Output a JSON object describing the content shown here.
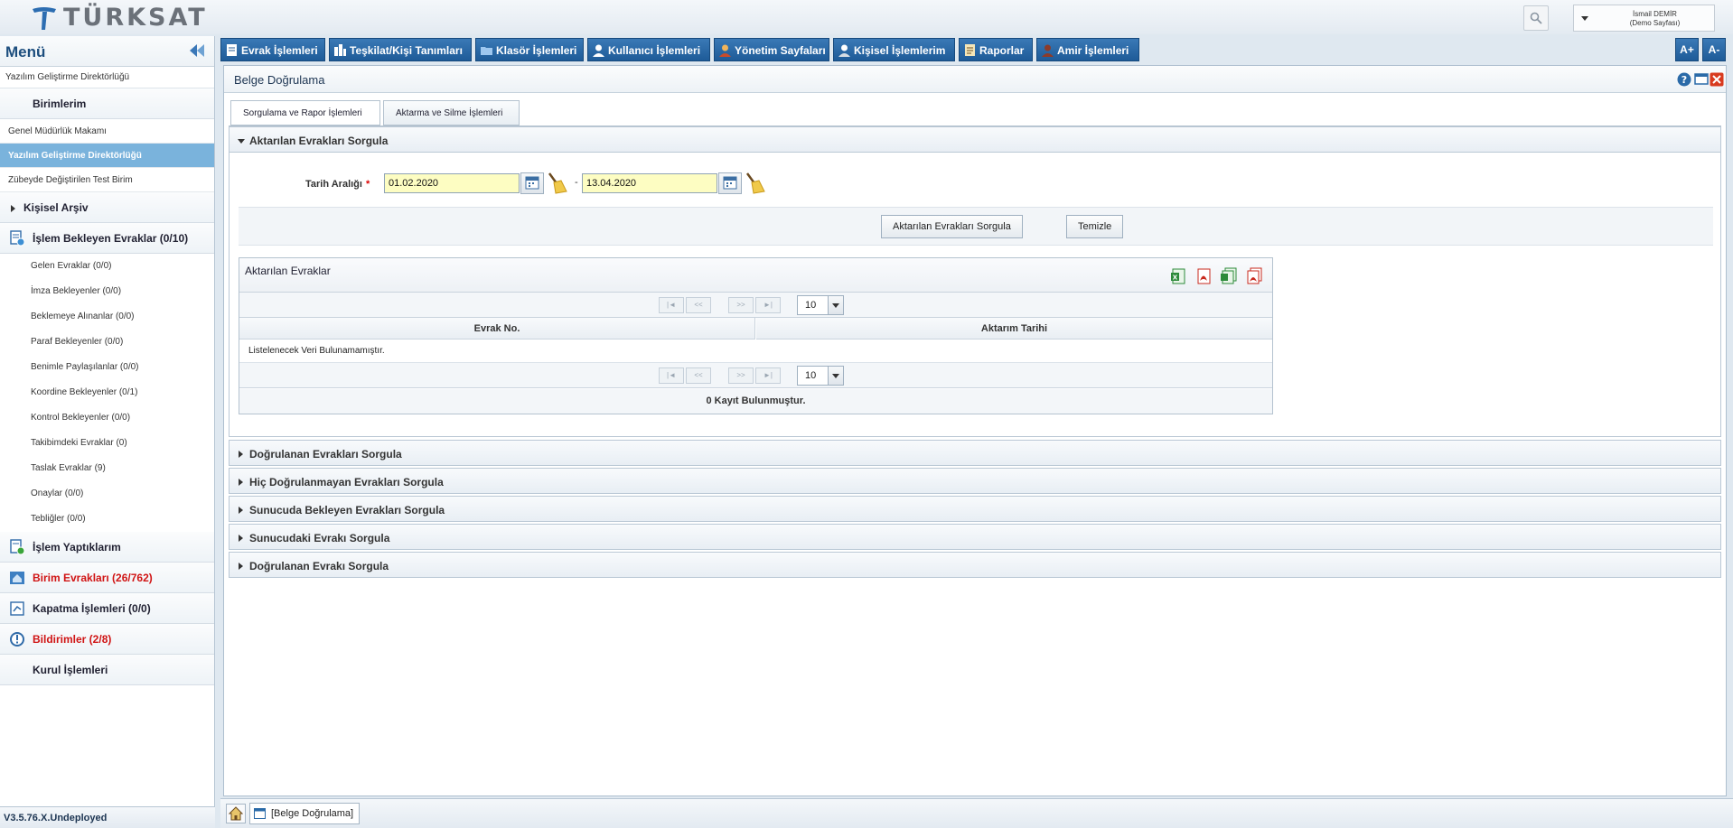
{
  "brand": {
    "name": "TÜRKSAT"
  },
  "user": {
    "name": "İsmail DEMİR",
    "role": "(Demo Sayfası)"
  },
  "sidebar": {
    "title": "Menü",
    "current_unit": "Yazılım Geliştirme Direktörlüğü",
    "units_header": "Birimlerim",
    "units": [
      "Genel Müdürlük Makamı",
      "Yazılım Geliştirme Direktörlüğü",
      "Zübeyde Değiştirilen Test Birim"
    ],
    "personal_archive": "Kişisel Arşiv",
    "pending_header": "İşlem Bekleyen Evraklar (0/10)",
    "pending_items": [
      "Gelen Evraklar (0/0)",
      "İmza Bekleyenler (0/0)",
      "Beklemeye Alınanlar (0/0)",
      "Paraf Bekleyenler (0/0)",
      "Benimle Paylaşılanlar (0/0)",
      "Koordine Bekleyenler (0/1)",
      "Kontrol Bekleyenler (0/0)",
      "Takibimdeki Evraklar (0)",
      "Taslak Evraklar (9)",
      "Onaylar (0/0)",
      "Tebliğler (0/0)"
    ],
    "done": "İşlem Yaptıklarım",
    "unit_docs": "Birim Evrakları (26/762)",
    "closing": "Kapatma İşlemleri (0/0)",
    "notifications": "Bildirimler (2/8)",
    "board": "Kurul İşlemleri",
    "version": "V3.5.76.X.Undeployed"
  },
  "nav": {
    "items": [
      "Evrak İşlemleri",
      "Teşkilat/Kişi Tanımları",
      "Klasör İşlemleri",
      "Kullanıcı İşlemleri",
      "Yönetim Sayfaları",
      "Kişisel İşlemlerim",
      "Raporlar",
      "Amir İşlemleri"
    ],
    "font_increase": "A+",
    "font_decrease": "A-"
  },
  "page": {
    "title": "Belge Doğrulama",
    "tabs": [
      "Sorgulama ve Rapor İşlemleri",
      "Aktarma ve Silme İşlemleri"
    ],
    "accordion_open": "Aktarılan Evrakları Sorgula",
    "accordions_closed": [
      "Doğrulanan Evrakları Sorgula",
      "Hiç Doğrulanmayan Evrakları Sorgula",
      "Sunucuda Bekleyen Evrakları Sorgula",
      "Sunucudaki Evrakı Sorgula",
      "Doğrulanan Evrakı Sorgula"
    ],
    "form": {
      "date_label": "Tarih Aralığı",
      "required_mark": "*",
      "date_from": "01.02.2020",
      "date_separator": "-",
      "date_to": "13.04.2020",
      "query_button": "Aktarılan Evrakları Sorgula",
      "clear_button": "Temizle"
    },
    "grid": {
      "title": "Aktarılan Evraklar",
      "page_size": "10",
      "columns": [
        "Evrak No.",
        "Aktarım Tarihi"
      ],
      "empty_message": "Listelenecek Veri Bulunamamıştır.",
      "footer": "0 Kayıt Bulunmuştur."
    }
  },
  "bottom": {
    "tab": "[Belge Doğrulama]"
  },
  "colors": {
    "nav_bg": "#2a6aa8",
    "active_unit": "#7ab3dc",
    "alert_red": "#d01414",
    "date_field": "#fdfdc2"
  }
}
